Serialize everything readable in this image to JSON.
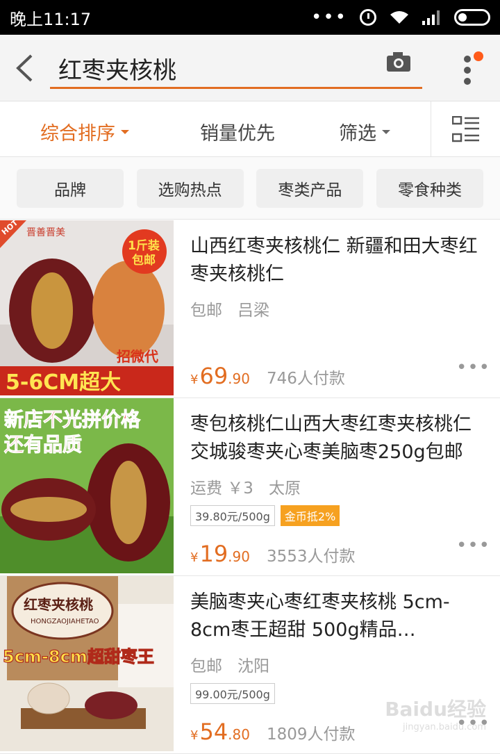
{
  "status_bar": {
    "time": "晚上11:17",
    "dots": "•••"
  },
  "search": {
    "query": "红枣夹核桃"
  },
  "sort": [
    {
      "label": "综合排序",
      "active": true,
      "dropdown": true
    },
    {
      "label": "销量优先",
      "active": false,
      "dropdown": false
    },
    {
      "label": "筛选",
      "active": false,
      "dropdown": true
    }
  ],
  "chips": [
    "品牌",
    "选购热点",
    "枣类产品",
    "零食种类"
  ],
  "products": [
    {
      "title": "山西红枣夹核桃仁 新疆和田大枣红枣夹核桃仁",
      "meta": [
        "包邮",
        "吕梁"
      ],
      "price_int": "69",
      "price_dec": ".90",
      "currency": "¥",
      "sold": "746人付款",
      "thumb": {
        "hot": "HOT",
        "brand": "晋善晋美",
        "badge_1": "1斤装",
        "badge_2": "包邮",
        "side": "招微代",
        "banner": "5-6CM超大"
      }
    },
    {
      "title": "枣包核桃仁山西大枣红枣夹核桃仁交城骏枣夹心枣美脑枣250g包邮",
      "meta": [
        "运费 ￥3",
        "太原"
      ],
      "unit_price": "39.80元/500g",
      "coin": "金币抵2%",
      "price_int": "19",
      "price_dec": ".90",
      "currency": "¥",
      "sold": "3553人付款",
      "thumb": {
        "line_1": "新店不光拼价格",
        "line_2": "还有品质"
      }
    },
    {
      "title": "美脑枣夹心枣红枣夹核桃 5cm-8cm枣王超甜 500g精品…",
      "meta": [
        "包邮",
        "沈阳"
      ],
      "unit_price": "99.00元/500g",
      "price_int": "54",
      "price_dec": ".80",
      "currency": "¥",
      "sold": "1809人付款",
      "thumb": {
        "bag_title": "红枣夹核桃",
        "bag_sub": "HONGZAOJIAHETAO",
        "banner": "5cm-8cm超甜枣王"
      }
    }
  ],
  "watermark": {
    "brand": "Baidu经验",
    "url": "jingyan.baidu.com"
  },
  "colors": {
    "accent": "#e26d21",
    "price": "#e26d21",
    "coin_tag": "#f6a120"
  }
}
